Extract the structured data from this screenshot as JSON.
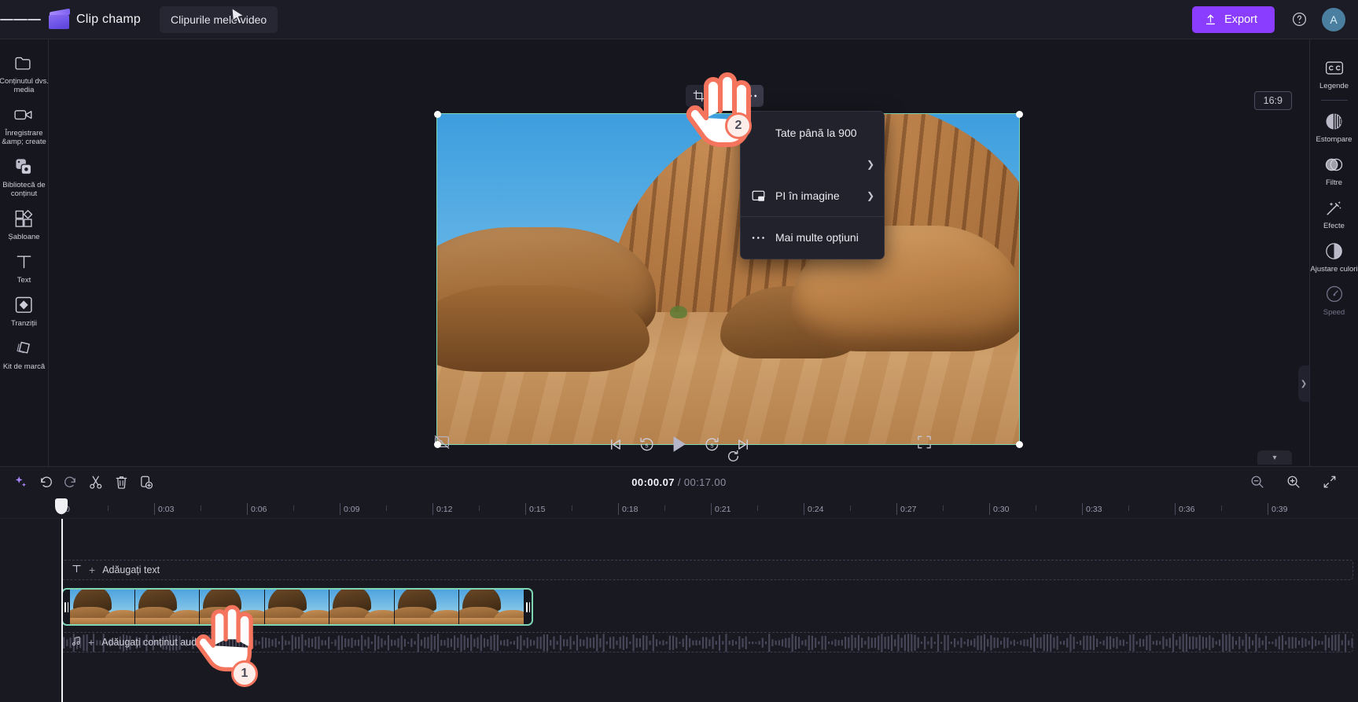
{
  "app": {
    "brand_name": "Clip champ",
    "project_tab": "Clipurile mele video"
  },
  "topbar": {
    "export_label": "Export",
    "help_icon": "question-circle-icon",
    "avatar_initial": "A",
    "menu_icon": "hamburger-icon"
  },
  "left_rail": [
    {
      "label": "Conținutul dvs. media",
      "icon": "folder-icon",
      "dim": false
    },
    {
      "label": "Înregistrare &amp; create",
      "icon": "video-camera-icon",
      "dim": false
    },
    {
      "label": "Bibliotecă de conținut",
      "icon": "content-library-icon",
      "dim": false
    },
    {
      "label": "Șabloane",
      "icon": "templates-icon",
      "dim": false
    },
    {
      "label": "Text",
      "icon": "text-icon",
      "dim": false
    },
    {
      "label": "Tranziții",
      "icon": "transitions-icon",
      "dim": false
    },
    {
      "label": "Kit de marcă",
      "icon": "brand-kit-icon",
      "dim": false
    }
  ],
  "right_rail": [
    {
      "label": "Legende",
      "icon": "closed-captions-icon",
      "dim": false
    },
    {
      "label": "Estompare",
      "icon": "blur-icon",
      "dim": false
    },
    {
      "label": "Filtre",
      "icon": "filters-icon",
      "dim": false
    },
    {
      "label": "Efecte",
      "icon": "effects-wand-icon",
      "dim": false
    },
    {
      "label": "Ajustare culori",
      "icon": "color-adjust-icon",
      "dim": false
    },
    {
      "label": "Speed",
      "icon": "speedometer-icon",
      "dim": true
    }
  ],
  "stage": {
    "ratio_badge": "16:9",
    "float_toolbar": [
      {
        "name": "crop-icon",
        "label": "Decupare"
      },
      {
        "name": "flip-icon",
        "label": "Răsturnare"
      },
      {
        "name": "more-options-icon",
        "label": "Mai multe opțiuni"
      }
    ],
    "reset_icon": "reset-icon"
  },
  "context_menu": {
    "items": [
      {
        "label": "Tate până la 900",
        "icon": "rotate-icon",
        "has_submenu": false
      },
      {
        "label": "",
        "icon": "",
        "has_submenu": true
      },
      {
        "label": "PI în imagine",
        "icon": "picture-in-picture-icon",
        "has_submenu": true
      }
    ],
    "more_label": "Mai multe opțiuni",
    "more_icon": "ellipsis-icon"
  },
  "player": {
    "captions_off_icon": "captions-off-icon",
    "skip_start_icon": "skip-to-start-icon",
    "back5_icon": "rewind-5-icon",
    "play_icon": "play-icon",
    "forward5_icon": "forward-5-icon",
    "skip_end_icon": "skip-to-end-icon",
    "fullscreen_icon": "fullscreen-icon"
  },
  "timeline": {
    "toolbar": [
      {
        "name": "ai-sparkle-icon",
        "label": "Instrumente AI"
      },
      {
        "name": "undo-icon",
        "label": "Anulare"
      },
      {
        "name": "redo-icon",
        "label": "Refacere"
      },
      {
        "name": "split-scissors-icon",
        "label": "Divizare"
      },
      {
        "name": "delete-trash-icon",
        "label": "Ștergere"
      },
      {
        "name": "duplicate-icon",
        "label": "Duplicare"
      }
    ],
    "current_time": "00:00.07",
    "separator": "/",
    "total_time": "00:17.00",
    "zoom_controls": [
      {
        "name": "zoom-out-icon",
        "label": "Micșorare"
      },
      {
        "name": "zoom-in-icon",
        "label": "Mărire"
      },
      {
        "name": "fit-to-screen-icon",
        "label": "Potrivire pe ecran"
      }
    ],
    "ruler_labels": [
      "0",
      "0:03",
      "0:06",
      "0:09",
      "0:12",
      "0:15",
      "0:18",
      "0:21",
      "0:24",
      "0:27",
      "0:30",
      "0:33",
      "0:36",
      "0:39"
    ],
    "tracks": {
      "text_track_label": "Adăugați text",
      "text_track_icon": "text-track-icon",
      "audio_track_label": "Adăugați conținut audio",
      "audio_track_icon": "music-note-icon",
      "video_clip_name": "video-clip"
    },
    "collapse_icon": "chevron-down-icon"
  },
  "annotations": [
    {
      "number": "1",
      "target": "video-clip-on-timeline"
    },
    {
      "number": "2",
      "target": "more-options-menu-button"
    }
  ]
}
